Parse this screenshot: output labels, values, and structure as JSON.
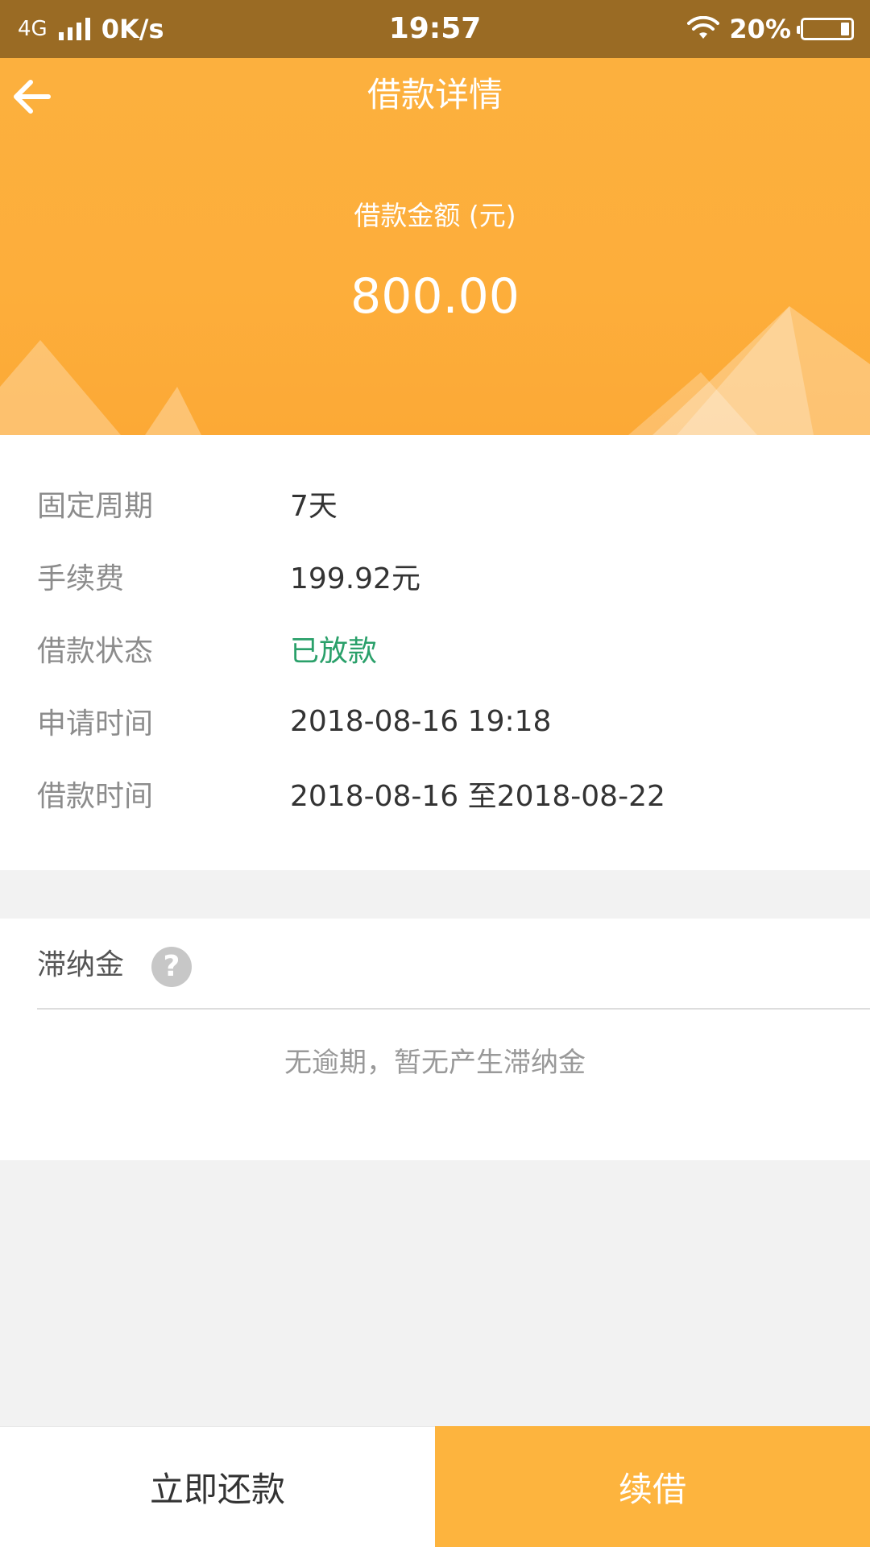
{
  "status_bar": {
    "network": "4G",
    "speed": "0K/s",
    "time": "19:57",
    "battery": "20%",
    "battery_level": 0.2,
    "icons": [
      "signal-icon",
      "wifi-icon",
      "battery-icon"
    ]
  },
  "header": {
    "title": "借款详情",
    "amount_label": "借款金额 (元)",
    "amount_value": "800.00",
    "back_icon": "arrow-left-icon"
  },
  "details": [
    {
      "label": "固定周期",
      "value": "7天"
    },
    {
      "label": "手续费",
      "value": "199.92元"
    },
    {
      "label": "借款状态",
      "value": "已放款"
    },
    {
      "label": "申请时间",
      "value": "2018-08-16 19:18"
    },
    {
      "label": "借款时间",
      "value": "2018-08-16 至2018-08-22"
    }
  ],
  "late_fee": {
    "title": "滞纳金",
    "help_symbol": "?",
    "message": "无逾期，暂无产生滞纳金"
  },
  "actions": {
    "repay_label": "立即还款",
    "renew_label": "续借"
  },
  "colors": {
    "accent": "#fdb43e",
    "status_bar": "#9a6b24",
    "status_green": "#2aa06a"
  }
}
